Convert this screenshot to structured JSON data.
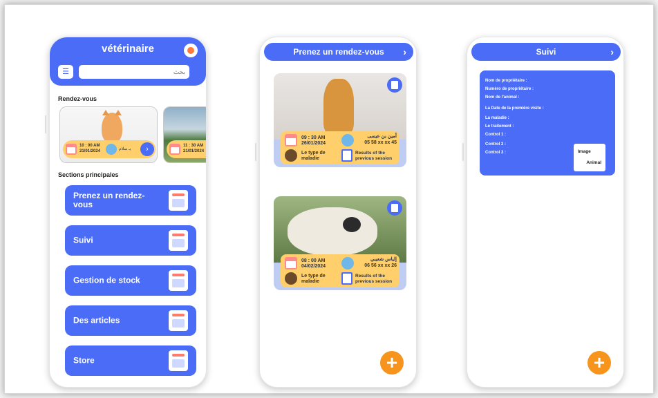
{
  "screen1": {
    "title": "vétérinaire",
    "search_placeholder": "بحث",
    "appointments_label": "Rendez-vous",
    "appointments": [
      {
        "time": "10 : 00 AM",
        "date": "21/01/2024",
        "name": "يـ سلام"
      },
      {
        "time": "11 : 30 AM",
        "date": "21/01/2024"
      }
    ],
    "sections_label": "Sections principales",
    "sections": [
      {
        "label": "Prenez un rendez-vous"
      },
      {
        "label": "Suivi"
      },
      {
        "label": "Gestion de stock"
      },
      {
        "label": "Des articles"
      },
      {
        "label": "Store"
      }
    ]
  },
  "screen2": {
    "title": "Prenez un rendez-vous",
    "cards": [
      {
        "time": "09 : 30 AM",
        "date": "26/01/2024",
        "name": "أمين بن عيسى",
        "phone": "05 58 xx xx 45",
        "type_label": "Le type de maladie",
        "results_label": "Results of the previous session"
      },
      {
        "time": "08 : 00 AM",
        "date": "04/02/2024",
        "name": "إلياس شعيبي",
        "phone": "06 56 xx xx 26",
        "type_label": "Le type de maladie",
        "results_label": "Results of the previous session"
      }
    ],
    "fab": "+"
  },
  "screen3": {
    "title": "Suivi",
    "fields": [
      "Nom de propriétaire :",
      "Numéro de propriétaire :",
      "Nom de l'animal :",
      "La Date de la première visite :",
      "La maladie :",
      "Le traitement :",
      "Control 1 :",
      "Control 2 :",
      "Control 3 :"
    ],
    "image_label": "Image",
    "animal_label": "Animal",
    "fab": "+"
  },
  "colors": {
    "primary": "#4a6cf7",
    "accent": "#f7941d",
    "highlight": "#ffcf6b"
  }
}
